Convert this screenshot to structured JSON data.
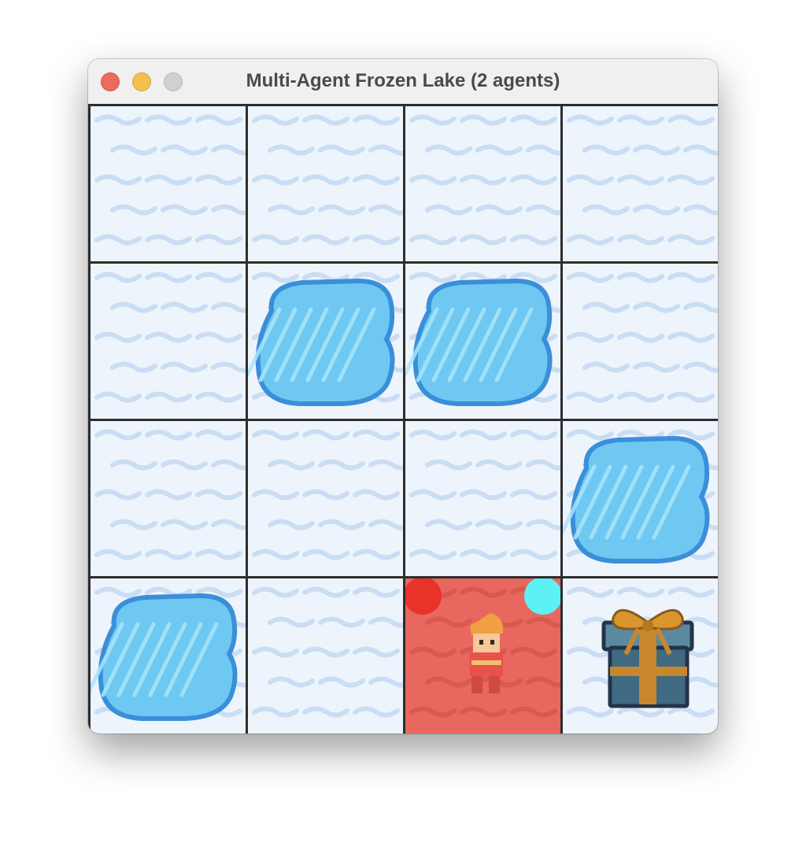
{
  "window": {
    "title": "Multi-Agent Frozen Lake (2 agents)"
  },
  "grid": {
    "rows": 4,
    "cols": 4,
    "cells": [
      [
        "ice",
        "ice",
        "ice",
        "ice"
      ],
      [
        "ice",
        "hole",
        "hole",
        "ice"
      ],
      [
        "ice",
        "ice",
        "ice",
        "hole"
      ],
      [
        "hole",
        "ice",
        "ice",
        "goal"
      ]
    ],
    "highlighted_cell": {
      "row": 3,
      "col": 2
    }
  },
  "agents": [
    {
      "id": "agent-1",
      "color": "#e8332a",
      "row": 3,
      "col": 2,
      "corner": "top-left"
    },
    {
      "id": "agent-2",
      "color": "#5cf1f5",
      "row": 3,
      "col": 2,
      "corner": "top-right"
    }
  ],
  "player": {
    "row": 3,
    "col": 2
  },
  "colors": {
    "ice_base": "#eef4fb",
    "ice_streak": "#c9ddf4",
    "hole_fill": "#6ec8f2",
    "hole_border": "#3a8fd9",
    "highlight": "#e8675e",
    "grid_line": "#2d2d2d"
  },
  "icons": {
    "close": "close-window-icon",
    "minimize": "minimize-window-icon",
    "maximize": "maximize-window-icon",
    "goal": "gift-box-icon",
    "player": "elf-character-icon"
  }
}
